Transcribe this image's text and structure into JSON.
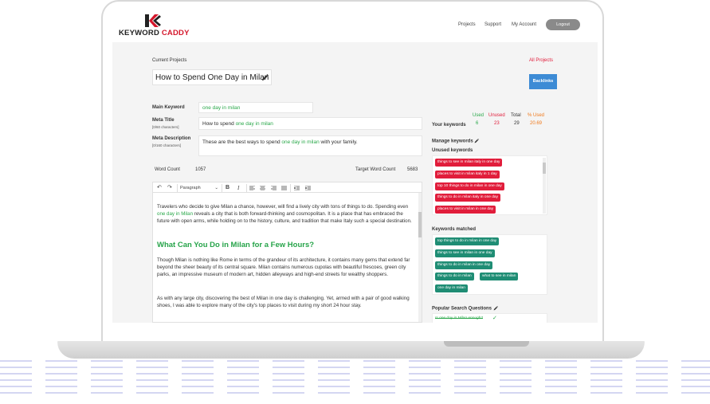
{
  "brand": {
    "name_part1": "KEYWORD ",
    "name_part2": "CADDY"
  },
  "nav": {
    "projects": "Projects",
    "support": "Support",
    "account": "My Account",
    "logout": "Logout"
  },
  "project": {
    "current_label": "Current Projects",
    "name": "How to Spend One Day in Milan",
    "all_projects": "All Projects",
    "backlinks": "Backlinks"
  },
  "seo": {
    "main_keyword_label": "Main Keyword",
    "main_keyword": "one day in milan",
    "meta_title_label": "Meta Title",
    "meta_title_chars": "[0/60 characters]",
    "meta_title_prefix": "How to spend ",
    "meta_title_keyword": "one day in milan",
    "meta_desc_label": "Meta Description",
    "meta_desc_chars": "[0/160 characters]",
    "meta_desc_prefix": "These are the best ways to spend ",
    "meta_desc_keyword": "one day in milan",
    "meta_desc_suffix": " with your family."
  },
  "counts": {
    "word_count_label": "Word Count",
    "word_count": "1057",
    "target_label": "Target Word Count",
    "target": "5683"
  },
  "toolbar": {
    "format": "Paragraph",
    "bold": "B",
    "italic": "I"
  },
  "article": {
    "p1_a": "Travelers who decide to give Milan a chance, however, will find a lively city with tons of things to do. Spending even ",
    "p1_kw": "one day in Milan",
    "p1_b": " reveals a city that is both forward-thinking and cosmopolitan. It is a place that has embraced the future with open arms, while holding on to the history, culture, and tradition that make Italy such a special destination.",
    "h2": "What Can You Do in Milan for a Few Hours?",
    "p2": "Though Milan is nothing like Rome in terms of the grandeur of its architecture, it contains many gems that extend far beyond the sheer beauty of its central square. Milan contains numerous cupolas with beautiful frescoes, green city parks, an impressive museum of modern art, hidden alleyways and high-end streets for wealthy shoppers.",
    "p3": "As with any large city, discovering the best of Milan in one day is challenging. Yet, armed with a pair of good walking shoes, I was able to explore many of the city's top places to visit during my short 24 hour stay."
  },
  "keywords": {
    "your_label": "Your keywords",
    "used_label": "Used",
    "used": "6",
    "unused_label": "Unused",
    "unused": "23",
    "total_label": "Total",
    "total": "29",
    "pct_label": "% Used",
    "pct": "20.69",
    "manage_label": "Manage keywords",
    "unused_heading": "Unused keywords",
    "unused_list": [
      "things to see in milan italy in one day",
      "places to visit in milan italy in 1 day",
      "top 10 things to do in milan in one day",
      "things to do in milan italy in one day",
      "places to visit in milan in one day"
    ],
    "matched_heading": "Keywords matched",
    "matched_list": [
      "top things to do in milan in one day",
      "things to see in milan in one day",
      "things to do in milan in one day",
      "things to do in milan",
      "what to see in milan",
      "one day in milan"
    ],
    "questions_heading": "Popular Search Questions",
    "question1": "Is one day in Milan enough?"
  },
  "colors": {
    "accent_red": "#e11d3b",
    "keyword_green": "#2aa84a",
    "chip_green": "#1f8d74",
    "button_blue": "#3d8bd5"
  }
}
